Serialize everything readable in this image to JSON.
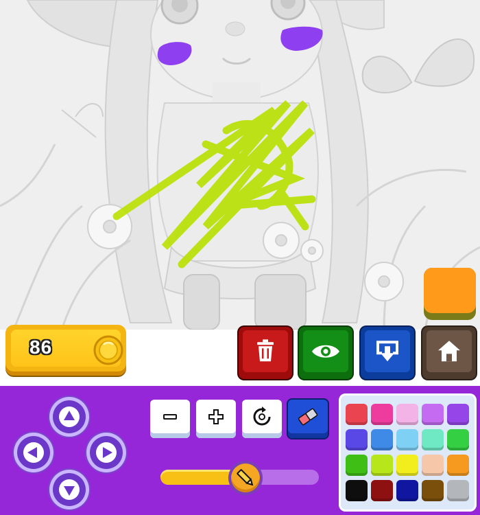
{
  "coins": {
    "count": "86"
  },
  "colors": {
    "current": "#ff9a1a",
    "scribble_yellow_green": "#b9e000",
    "scribble_purple": "#8e3ff0",
    "panel": "#9627d9"
  },
  "actions": [
    {
      "name": "delete",
      "icon": "trash-icon"
    },
    {
      "name": "preview",
      "icon": "eye-icon"
    },
    {
      "name": "save",
      "icon": "download-icon"
    },
    {
      "name": "home",
      "icon": "home-icon"
    }
  ],
  "tools": [
    {
      "name": "zoom-out",
      "icon": "minus-icon"
    },
    {
      "name": "zoom-in",
      "icon": "plus-icon"
    },
    {
      "name": "reset",
      "icon": "rotate-icon"
    },
    {
      "name": "eraser",
      "icon": "eraser-icon"
    }
  ],
  "brush_size": {
    "level": 0.53
  },
  "palette": [
    [
      "#e94450",
      "#ee3c9e",
      "#f3b3e6",
      "#c46bf2",
      "#9646e8"
    ],
    [
      "#5a48e6",
      "#3f8ae6",
      "#7fd0f5",
      "#6fe8c4",
      "#34cf42"
    ],
    [
      "#3fbf16",
      "#b7e61a",
      "#f2ee1e",
      "#f7c7aa",
      "#f59a1f"
    ],
    [
      "#0e0e0e",
      "#8e1111",
      "#1016a0",
      "#7a4f0c",
      "#b3b7bb"
    ]
  ]
}
